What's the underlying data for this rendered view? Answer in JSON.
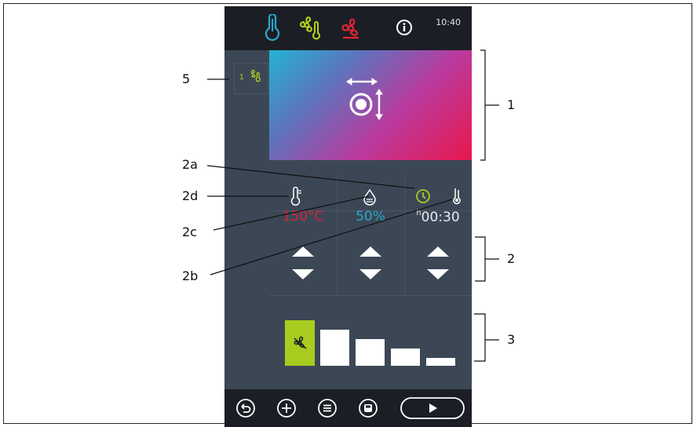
{
  "status_bar": {
    "time": "10:40",
    "icons": [
      "thermometer-icon",
      "fan-thermometer-icon",
      "fan-icon",
      "info-icon"
    ]
  },
  "program": {
    "step_number": "1",
    "step_icon": "fan-thermometer-icon"
  },
  "parameters": [
    {
      "name": "temperature",
      "icon": "thermometer-icon",
      "value": "150°C",
      "color": "#d8243a"
    },
    {
      "name": "humidity",
      "icon": "droplet-icon",
      "value": "50%",
      "color": "#24a7d0"
    },
    {
      "name": "time",
      "icon": "clock-icon",
      "prefix": "h",
      "value": "00:30",
      "color": "#eaeaea"
    },
    {
      "name": "core-probe",
      "icon": "core-probe-icon"
    }
  ],
  "fan_levels": {
    "icon": "fan-icon",
    "active_level": 1,
    "count": 5,
    "accent": "#a8cc1f"
  },
  "bottom_bar": {
    "icons": [
      "back-icon",
      "add-icon",
      "menu-icon",
      "save-icon",
      "play-icon"
    ]
  },
  "callouts": {
    "c1": "1",
    "c2": "2",
    "c2a": "2a",
    "c2b": "2b",
    "c2c": "2c",
    "c2d": "2d",
    "c3": "3",
    "c5": "5"
  }
}
